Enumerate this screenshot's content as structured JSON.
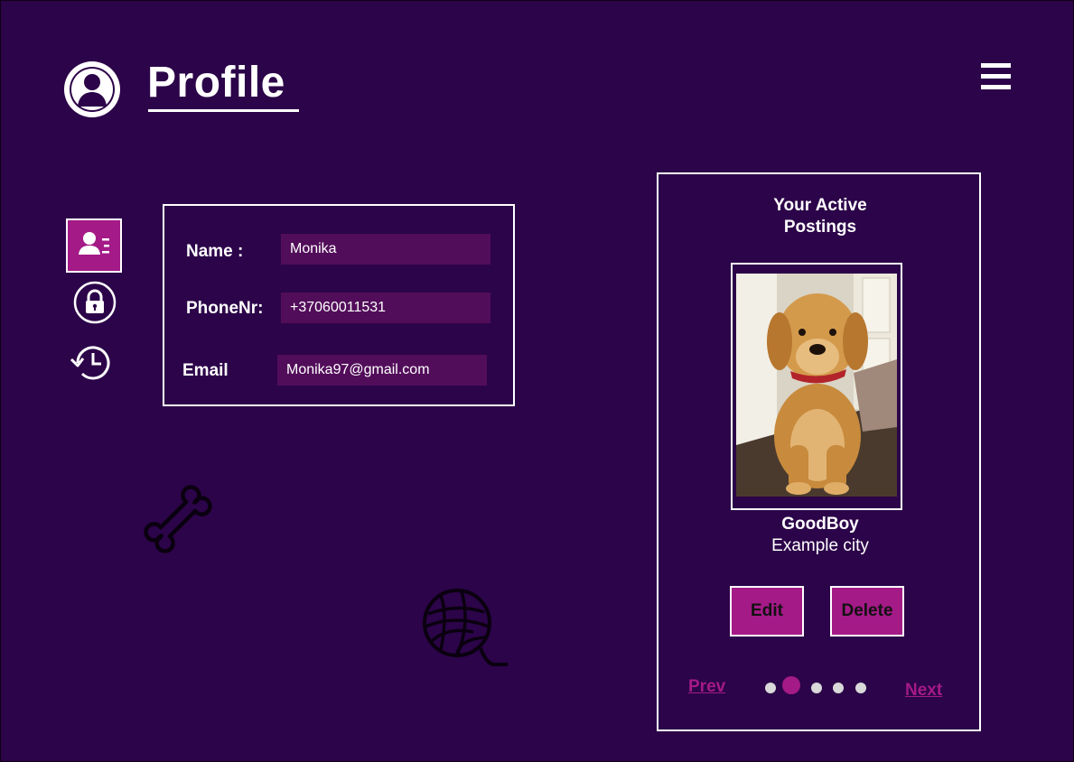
{
  "header": {
    "title": "Profile",
    "avatar_icon": "user-avatar-icon",
    "menu_icon": "hamburger-menu-icon"
  },
  "nav": [
    {
      "name": "profile-card",
      "icon": "id-card-icon",
      "active": true
    },
    {
      "name": "security",
      "icon": "lock-icon",
      "active": false
    },
    {
      "name": "history",
      "icon": "history-icon",
      "active": false
    }
  ],
  "profile": {
    "name_label": "Name :",
    "name_value": "Monika",
    "phone_label": "PhoneNr:",
    "phone_value": "+37060011531",
    "email_label": "Email",
    "email_value": "Monika97@gmail.com"
  },
  "postings": {
    "heading": "Your Active Postings",
    "pet_name": "GoodBoy",
    "pet_city": "Example city",
    "edit_label": "Edit",
    "delete_label": "Delete",
    "prev_label": "Prev",
    "next_label": "Next",
    "page_count": 5,
    "current_page": 2
  },
  "decorations": [
    "bone-icon",
    "yarn-ball-icon"
  ],
  "colors": {
    "background": "#2c0449",
    "accent": "#a41a87",
    "input_bg": "#520d5a",
    "text": "#ffffff"
  }
}
